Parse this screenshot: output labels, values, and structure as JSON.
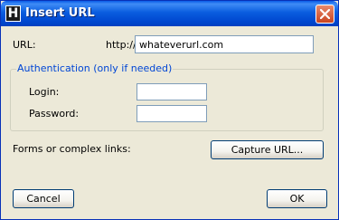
{
  "window": {
    "title": "Insert URL",
    "app_icon_letter": "H",
    "close_icon": "close-icon"
  },
  "url_section": {
    "label": "URL:",
    "prefix": "http://",
    "value": "whateverurl.com"
  },
  "authentication": {
    "legend": "Authentication (only if needed)",
    "login_label": "Login:",
    "login_value": "",
    "password_label": "Password:",
    "password_value": ""
  },
  "forms": {
    "label": "Forms or complex links:",
    "capture_button": "Capture URL..."
  },
  "footer": {
    "cancel_button": "Cancel",
    "ok_button": "OK"
  },
  "colors": {
    "titlebar": "#0a5ddf",
    "dialog_background": "#ece9d8",
    "group_legend": "#0046d5",
    "close_button": "#c94420"
  }
}
